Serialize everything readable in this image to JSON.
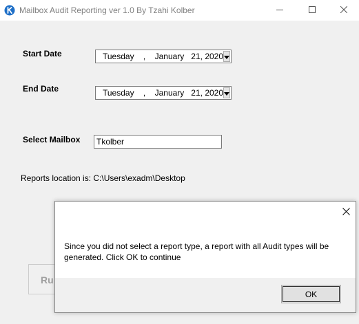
{
  "window": {
    "title": "Mailbox Audit Reporting ver 1.0 By Tzahi Kolber",
    "icon": "app-k-icon",
    "accent_color": "#1e6fc7",
    "controls": [
      "minimize-icon",
      "maximize-icon",
      "close-icon"
    ]
  },
  "form": {
    "start_date_label": "Start Date",
    "start_date": {
      "weekday": "Tuesday",
      "sep": ",",
      "month": "January",
      "day_year": "21, 2020"
    },
    "end_date_label": "End Date",
    "end_date": {
      "weekday": "Tuesday",
      "sep": ",",
      "month": "January",
      "day_year": "21, 2020"
    },
    "select_mailbox_label": "Select Mailbox",
    "mailbox_value": "Tkolber",
    "reports_location": "Reports location is: C:\\Users\\exadm\\Desktop",
    "run_button_label": "Ru"
  },
  "dialog": {
    "message": "Since you did not select a report type, a report with all Audit types will be generated. Click OK to continue",
    "ok_label": "OK"
  }
}
